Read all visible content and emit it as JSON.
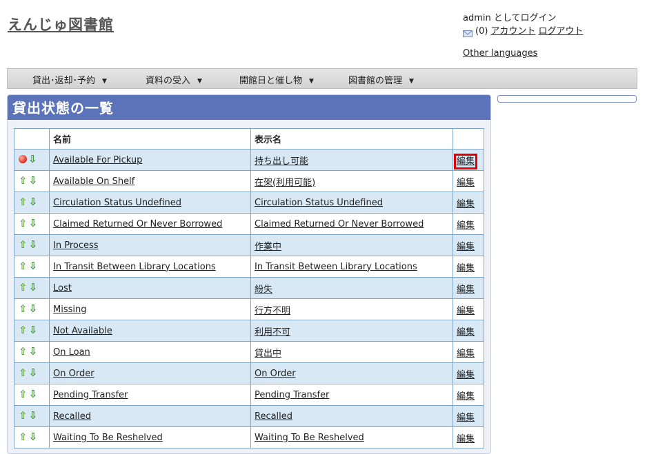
{
  "site": {
    "title": "えんじゅ図書館"
  },
  "user": {
    "login_text": "admin としてログイン",
    "message_count": "(0)",
    "account_link": "アカウント",
    "logout_link": "ログアウト",
    "other_languages": "Other languages"
  },
  "menu": [
    {
      "label": "貸出･返却･予約"
    },
    {
      "label": "資料の受入"
    },
    {
      "label": "開館日と催し物"
    },
    {
      "label": "図書館の管理"
    }
  ],
  "page": {
    "heading": "貸出状態の一覧"
  },
  "table": {
    "headers": {
      "name": "名前",
      "display_name": "表示名"
    },
    "edit_label": "編集",
    "rows": [
      {
        "name": "Available For Pickup",
        "display_name": "持ち出し可能"
      },
      {
        "name": "Available On Shelf",
        "display_name": "在架(利用可能)"
      },
      {
        "name": "Circulation Status Undefined",
        "display_name": "Circulation Status Undefined"
      },
      {
        "name": "Claimed Returned Or Never Borrowed",
        "display_name": "Claimed Returned Or Never Borrowed"
      },
      {
        "name": "In Process",
        "display_name": "作業中"
      },
      {
        "name": "In Transit Between Library Locations",
        "display_name": "In Transit Between Library Locations"
      },
      {
        "name": "Lost",
        "display_name": "紛失"
      },
      {
        "name": "Missing",
        "display_name": "行方不明"
      },
      {
        "name": "Not Available",
        "display_name": "利用不可"
      },
      {
        "name": "On Loan",
        "display_name": "貸出中"
      },
      {
        "name": "On Order",
        "display_name": "On Order"
      },
      {
        "name": "Pending Transfer",
        "display_name": "Pending Transfer"
      },
      {
        "name": "Recalled",
        "display_name": "Recalled"
      },
      {
        "name": "Waiting To Be Reshelved",
        "display_name": "Waiting To Be Reshelved"
      }
    ]
  }
}
